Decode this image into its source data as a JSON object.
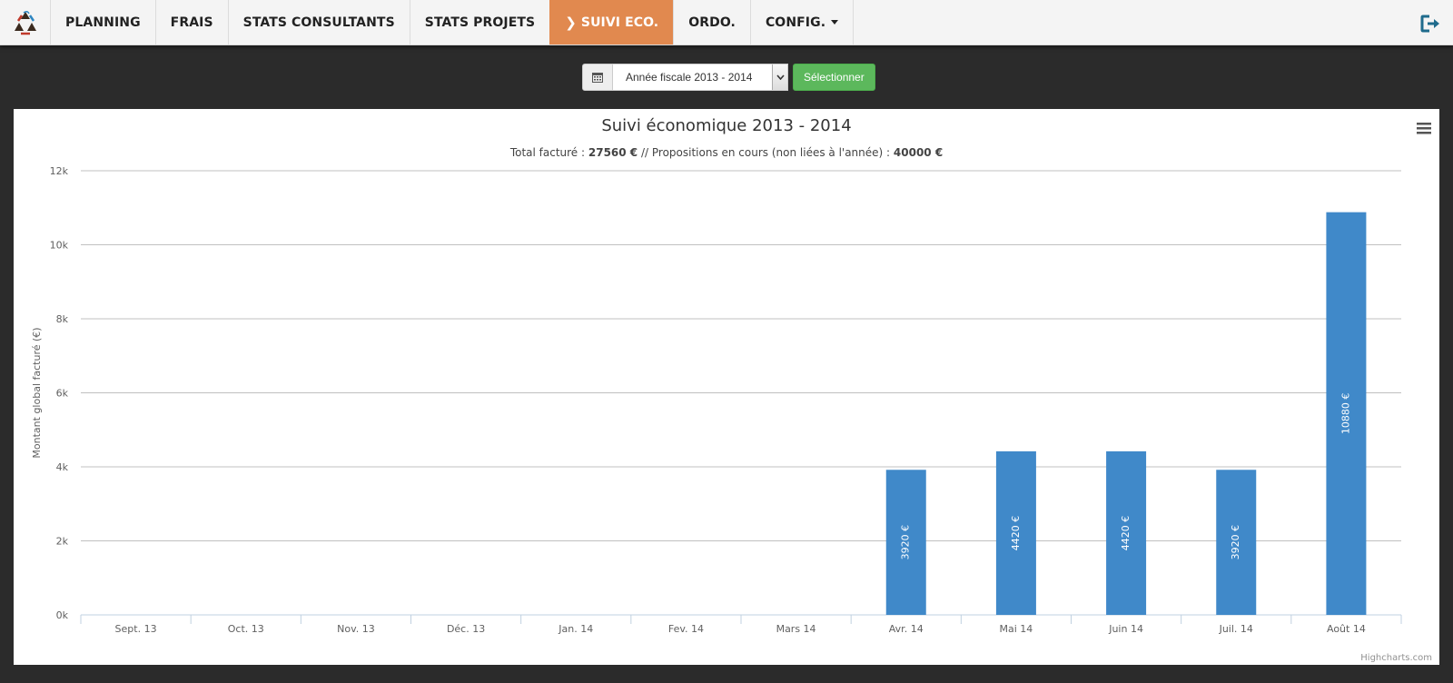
{
  "nav": {
    "items": [
      {
        "label": "PLANNING",
        "active": false
      },
      {
        "label": "FRAIS",
        "active": false
      },
      {
        "label": "STATS CONSULTANTS",
        "active": false
      },
      {
        "label": "STATS PROJETS",
        "active": false
      },
      {
        "label": "SUIVI ECO.",
        "active": true
      },
      {
        "label": "ORDO.",
        "active": false
      },
      {
        "label": "CONFIG.",
        "active": false,
        "dropdown": true
      }
    ],
    "logout_icon": "sign-out-icon",
    "logo_icon": "recycle-logo-icon"
  },
  "filter": {
    "calendar_icon": "calendar-icon",
    "selected": "Année fiscale 2013 - 2014",
    "button": "Sélectionner"
  },
  "colors": {
    "active_tab": "#e1894f",
    "bar": "#4089c9",
    "button": "#5cb85c",
    "page_bg": "#2b2b2b"
  },
  "chart": {
    "subtitle_prefix": "Total facturé : ",
    "total": "27560 €",
    "subtitle_sep": " // Propositions en cours (non liées à l'année) : ",
    "proposals": "40000 €",
    "credits": "Highcharts.com"
  },
  "chart_data": {
    "type": "bar",
    "title": "Suivi économique 2013 - 2014",
    "ylabel": "Montant global facturé (€)",
    "xlabel": "",
    "ylim": [
      0,
      12000
    ],
    "ytick_labels": [
      "0k",
      "2k",
      "4k",
      "6k",
      "8k",
      "10k",
      "12k"
    ],
    "grid": true,
    "categories": [
      "Sept. 13",
      "Oct. 13",
      "Nov. 13",
      "Déc. 13",
      "Jan. 14",
      "Fev. 14",
      "Mars 14",
      "Avr. 14",
      "Mai 14",
      "Juin 14",
      "Juil. 14",
      "Août 14"
    ],
    "values": [
      0,
      0,
      0,
      0,
      0,
      0,
      0,
      3920,
      4420,
      4420,
      3920,
      10880
    ],
    "data_labels": [
      "",
      "",
      "",
      "",
      "",
      "",
      "",
      "3920 €",
      "4420 €",
      "4420 €",
      "3920 €",
      "10880 €"
    ]
  }
}
